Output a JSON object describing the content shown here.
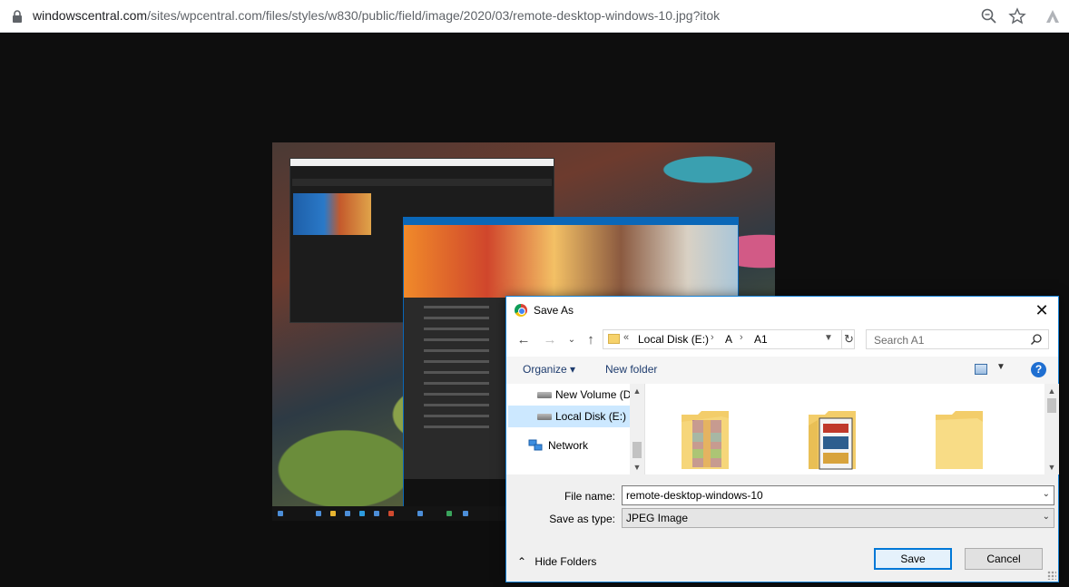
{
  "browser": {
    "url_host": "windowscentral.com",
    "url_path": "/sites/wpcentral.com/files/styles/w830/public/field/image/2020/03/remote-desktop-windows-10.jpg?itok",
    "icons": [
      "lock-icon",
      "zoom-icon",
      "star-icon",
      "extension-icon"
    ]
  },
  "image": {
    "description_icons": [
      "remote-desktop-window",
      "start-menu",
      "taskbar"
    ]
  },
  "dialog": {
    "title": "Save As",
    "nav": {
      "path_prefix": "«",
      "path": [
        "Local Disk (E:)",
        "A",
        "A1"
      ],
      "search_placeholder": "Search A1"
    },
    "toolbar": {
      "organize": "Organize ▾",
      "new_folder": "New folder"
    },
    "nav_pane": [
      {
        "label": "New Volume (D",
        "type": "drive"
      },
      {
        "label": "Local Disk (E:)",
        "type": "drive",
        "selected": true
      },
      {
        "label": "Network",
        "type": "network"
      }
    ],
    "form": {
      "file_name_label": "File name:",
      "file_name": "remote-desktop-windows-10",
      "type_label": "Save as type:",
      "type": "JPEG Image"
    },
    "hide_folders": "Hide Folders",
    "save": "Save",
    "cancel": "Cancel"
  },
  "colors": {
    "accent": "#0078d7",
    "selection": "#cce8ff",
    "folder": "#f6d26b"
  }
}
